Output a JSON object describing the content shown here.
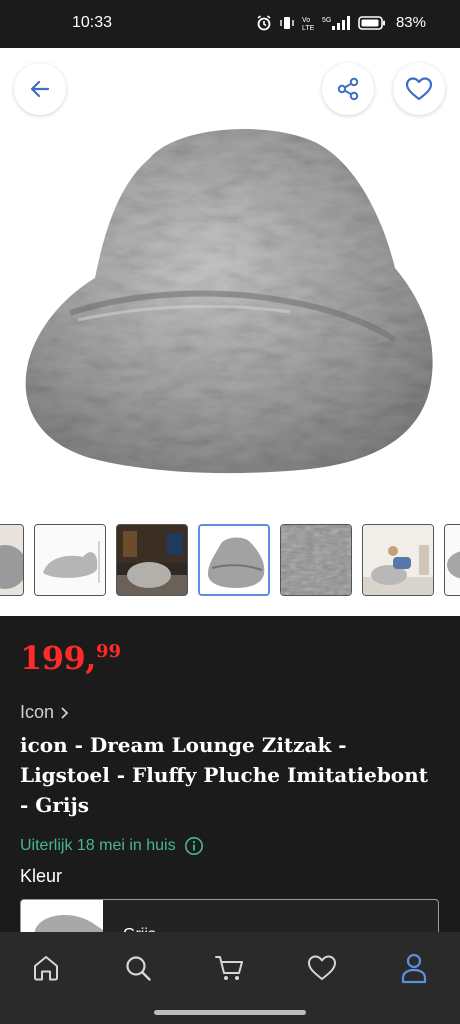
{
  "status_bar": {
    "time": "10:33",
    "battery": "83%",
    "icons": [
      "alarm-icon",
      "vibrate-icon",
      "volte-icon",
      "5g-signal-icon",
      "battery-icon"
    ]
  },
  "header": {
    "back_icon": "arrow-left-icon",
    "share_icon": "share-icon",
    "favorite_icon": "heart-icon"
  },
  "product": {
    "price_main": "199,",
    "price_cents": "99",
    "brand": "Icon",
    "title": "icon - Dream Lounge Zitzak - Ligstoel - Fluffy Pluche Imitatiebont - Grijs",
    "delivery": "Uiterlijk 18 mei in huis",
    "color_label": "Kleur",
    "selected_variant": "Grijs"
  },
  "gallery": {
    "thumbnail_count": 7,
    "selected_index": 3
  },
  "bottom_nav": {
    "items": [
      "home-icon",
      "search-icon",
      "cart-icon",
      "heart-icon",
      "user-icon"
    ],
    "active": "user-icon"
  },
  "colors": {
    "price": "#ff2a2a",
    "delivery": "#48b88a",
    "accent": "#5e8ee0",
    "background": "#1b1b1b"
  }
}
